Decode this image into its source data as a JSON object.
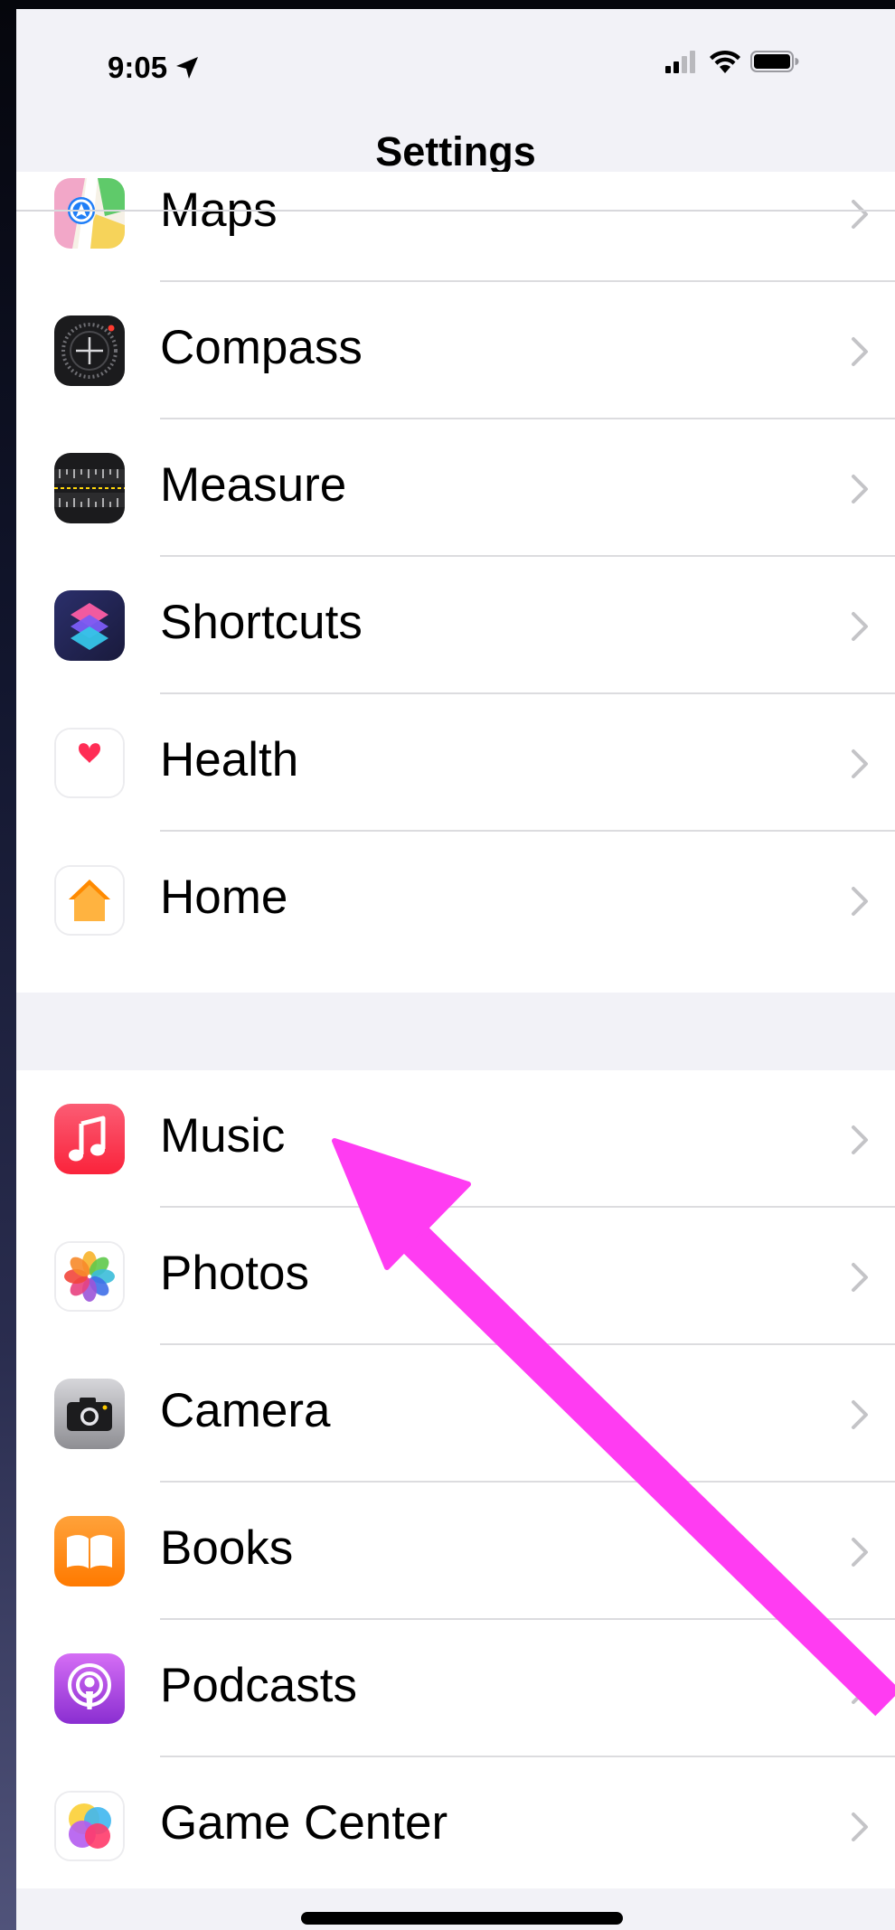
{
  "status_bar": {
    "time": "9:05",
    "location_icon": "location-arrow-icon",
    "signal_icon": "cellular-signal-icon",
    "wifi_icon": "wifi-icon",
    "battery_icon": "battery-icon"
  },
  "nav": {
    "title": "Settings"
  },
  "groups": [
    {
      "items": [
        {
          "label": "Maps",
          "icon": "maps-icon"
        },
        {
          "label": "Compass",
          "icon": "compass-icon"
        },
        {
          "label": "Measure",
          "icon": "measure-icon"
        },
        {
          "label": "Shortcuts",
          "icon": "shortcuts-icon"
        },
        {
          "label": "Health",
          "icon": "health-icon"
        },
        {
          "label": "Home",
          "icon": "home-icon"
        }
      ]
    },
    {
      "items": [
        {
          "label": "Music",
          "icon": "music-icon"
        },
        {
          "label": "Photos",
          "icon": "photos-icon"
        },
        {
          "label": "Camera",
          "icon": "camera-icon"
        },
        {
          "label": "Books",
          "icon": "books-icon"
        },
        {
          "label": "Podcasts",
          "icon": "podcasts-icon"
        },
        {
          "label": "Game Center",
          "icon": "game-center-icon"
        }
      ]
    }
  ],
  "annotation": {
    "type": "arrow",
    "color": "#ff3cf2",
    "points_to": "Music"
  },
  "colors": {
    "background": "#f2f2f7",
    "cell": "#ffffff",
    "chevron": "#c4c4c7",
    "separator": "#dcdcdf"
  }
}
